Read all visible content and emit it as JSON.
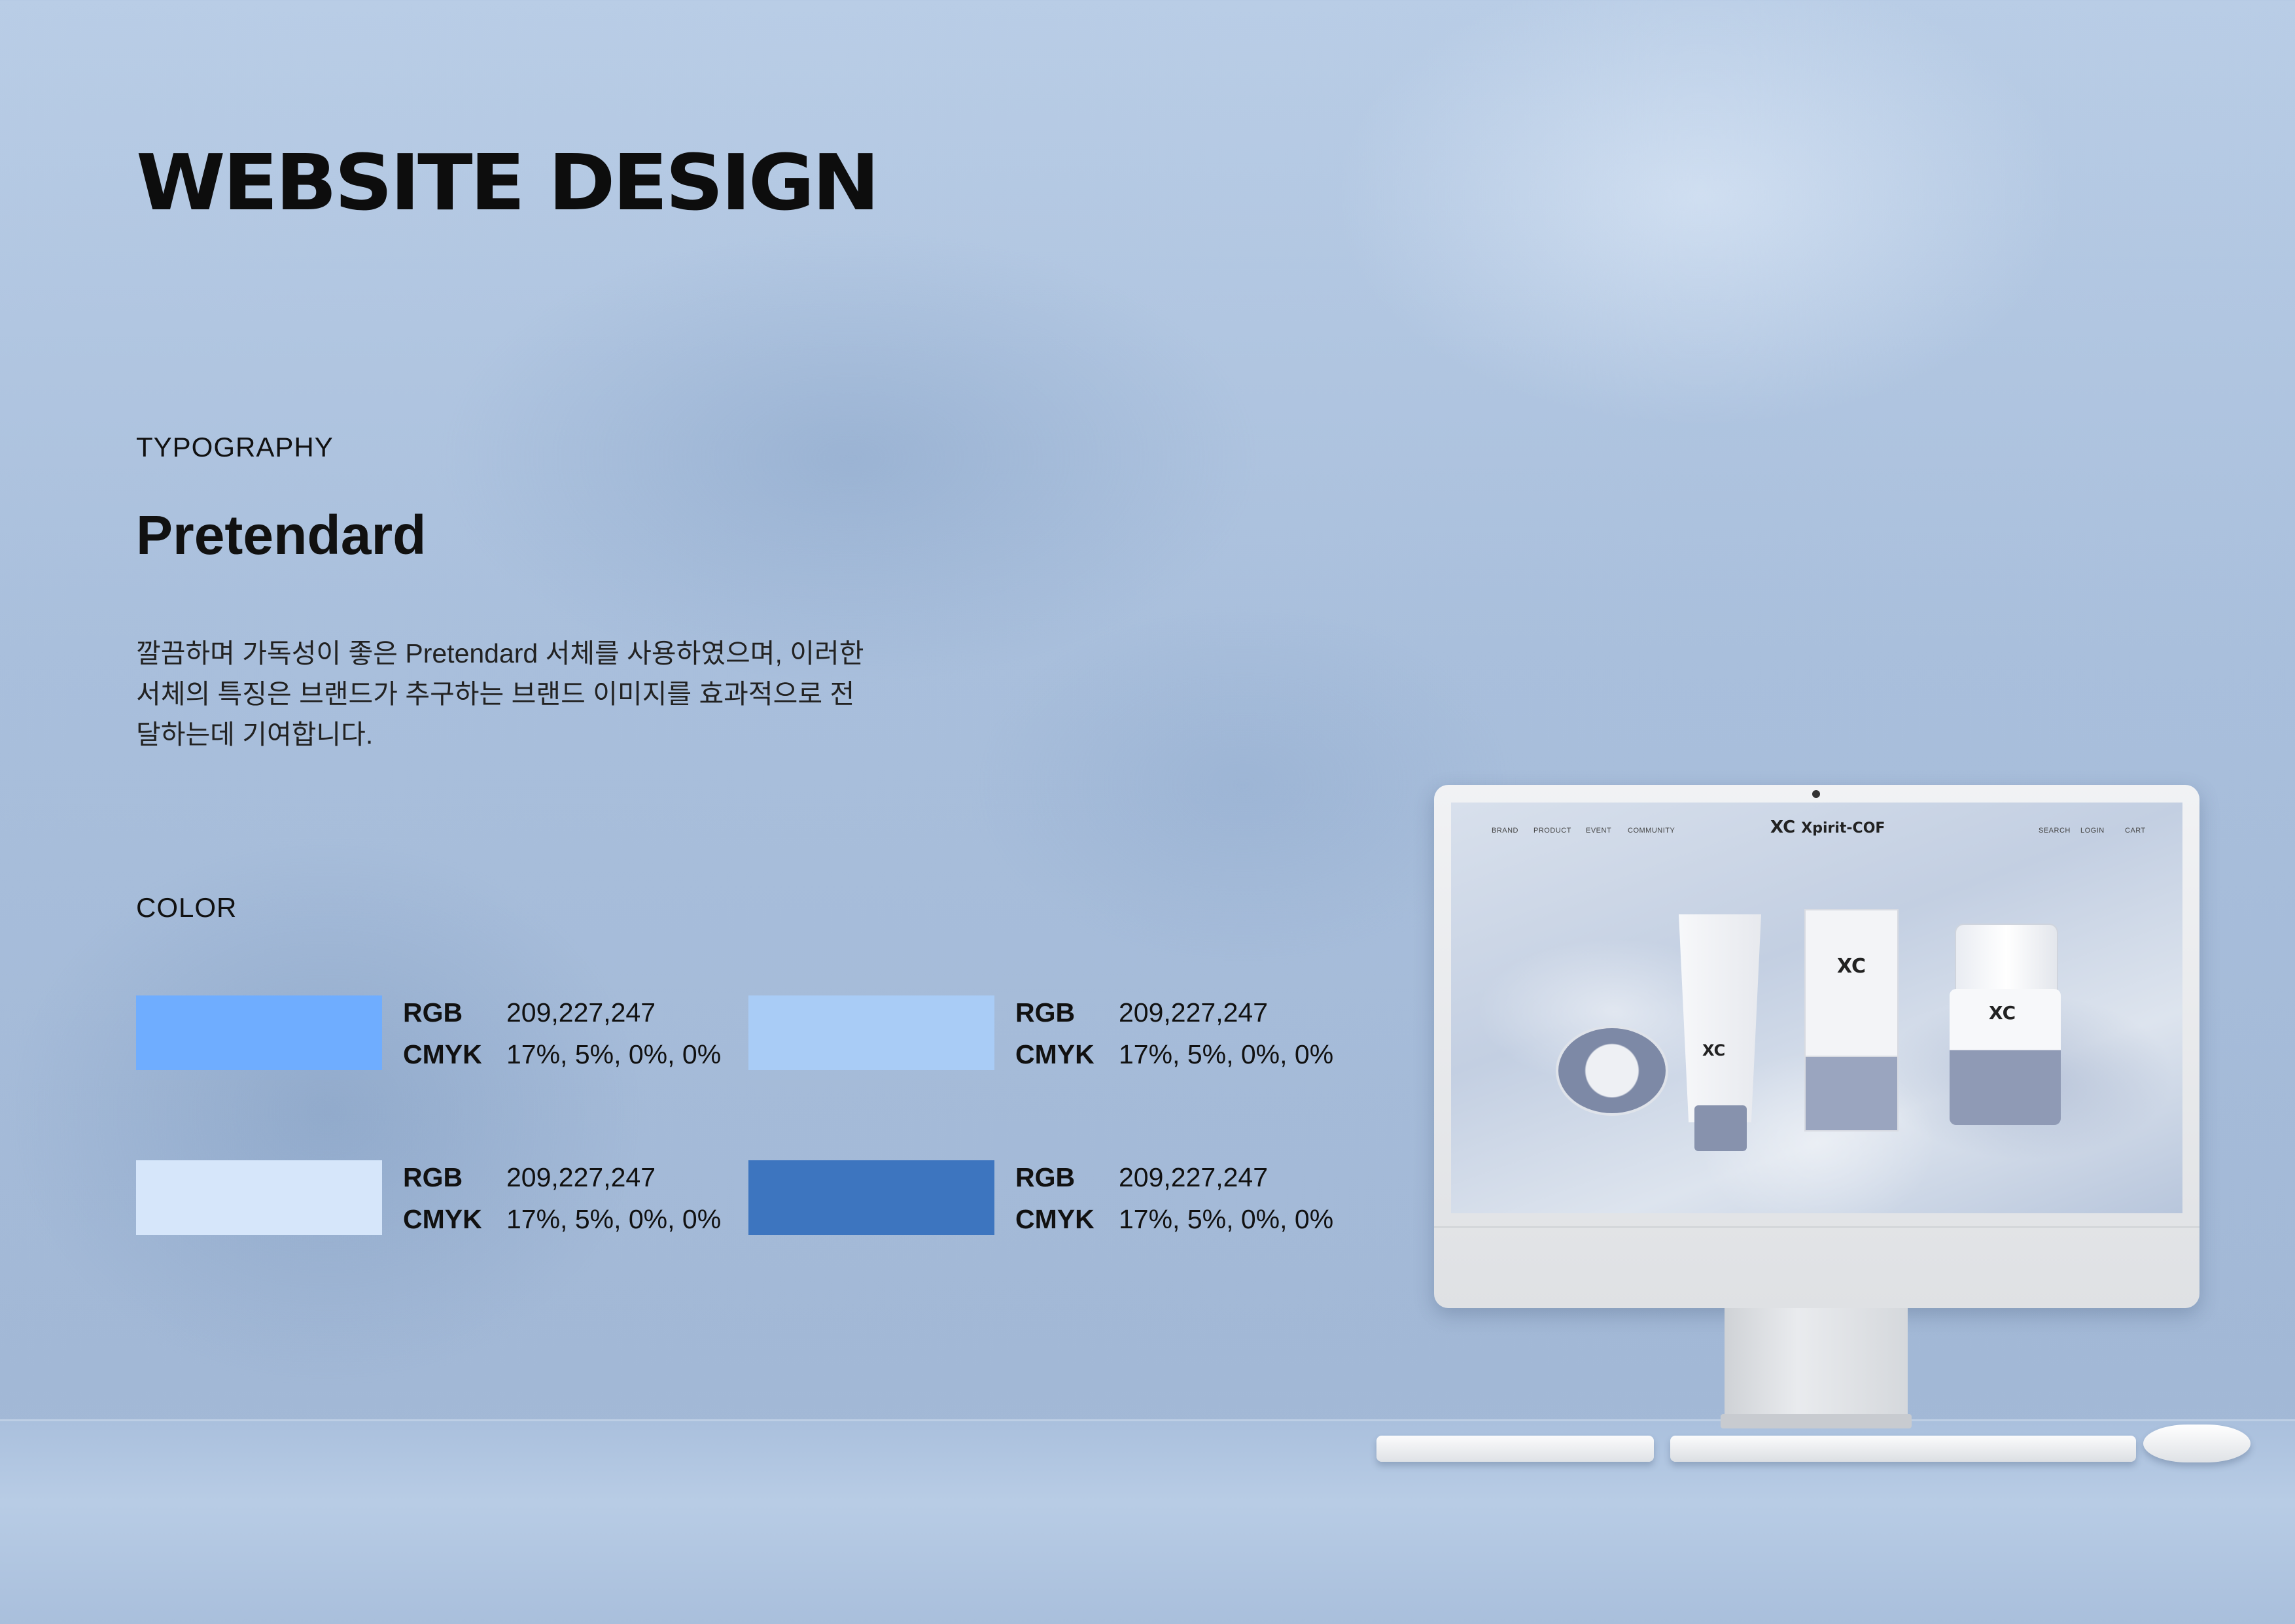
{
  "header": {
    "title": "WEBSITE DESIGN"
  },
  "typography": {
    "label": "TYPOGRAPHY",
    "font_name": "Pretendard",
    "description": "깔끔하며 가독성이 좋은 Pretendard 서체를 사용하였으며, 이러한 서체의 특징은 브랜드가 추구하는 브랜드 이미지를 효과적으로 전달하는데 기여합니다."
  },
  "color": {
    "label": "COLOR",
    "swatches": [
      {
        "hex": "#6fadff",
        "rgb_label": "RGB",
        "rgb_value": "209,227,247",
        "cmyk_label": "CMYK",
        "cmyk_value": "17%, 5%, 0%, 0%"
      },
      {
        "hex": "#a9ccf6",
        "rgb_label": "RGB",
        "rgb_value": "209,227,247",
        "cmyk_label": "CMYK",
        "cmyk_value": "17%, 5%, 0%, 0%"
      },
      {
        "hex": "#d6e6fa",
        "rgb_label": "RGB",
        "rgb_value": "209,227,247",
        "cmyk_label": "CMYK",
        "cmyk_value": "17%, 5%, 0%, 0%"
      },
      {
        "hex": "#3d75bf",
        "rgb_label": "RGB",
        "rgb_value": "209,227,247",
        "cmyk_label": "CMYK",
        "cmyk_value": "17%, 5%, 0%, 0%"
      }
    ]
  },
  "mockup": {
    "nav_left": [
      "BRAND",
      "PRODUCT",
      "EVENT",
      "COMMUNITY"
    ],
    "brand_mark": "XC",
    "brand_name": "Xpirit-COF",
    "nav_right": [
      "SEARCH",
      "LOGIN",
      "CART"
    ]
  }
}
